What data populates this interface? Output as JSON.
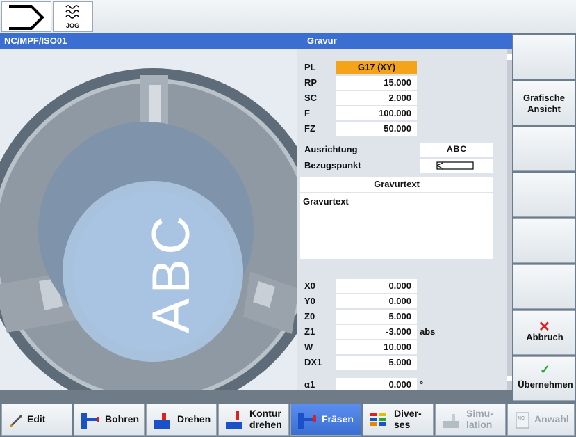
{
  "topbar": {
    "mode_label": "JOG"
  },
  "titlebar": {
    "program": "NC/MPF/ISO01",
    "cycle": "Gravur"
  },
  "graphic": {
    "engrave_text": "ABC"
  },
  "params": {
    "top_rows": [
      {
        "label": "PL",
        "value": "G17 (XY)"
      },
      {
        "label": "RP",
        "value": "15.000"
      },
      {
        "label": "SC",
        "value": "2.000"
      },
      {
        "label": "F",
        "value": "100.000"
      },
      {
        "label": "FZ",
        "value": "50.000"
      }
    ],
    "ausrichtung": {
      "label": "Ausrichtung",
      "value": "ABC"
    },
    "bezugspunkt": {
      "label": "Bezugspunkt"
    },
    "gravurtext": {
      "header": "Gravurtext",
      "value": "Gravurtext"
    },
    "bottom_rows": [
      {
        "label": "X0",
        "value": "0.000",
        "unit": ""
      },
      {
        "label": "Y0",
        "value": "0.000",
        "unit": ""
      },
      {
        "label": "Z0",
        "value": "5.000",
        "unit": ""
      },
      {
        "label": "Z1",
        "value": "-3.000",
        "unit": "abs"
      },
      {
        "label": "W",
        "value": "10.000",
        "unit": ""
      },
      {
        "label": "DX1",
        "value": "5.000",
        "unit": ""
      },
      {
        "label": "α1",
        "value": "0.000",
        "unit": "°"
      }
    ]
  },
  "softkeys": {
    "grafische": "Grafische Ansicht",
    "abbruch": "Abbruch",
    "uebernehmen": "Übernehmen"
  },
  "hkeys": {
    "edit": "Edit",
    "bohren": "Bohren",
    "drehen": "Drehen",
    "kontur_line1": "Kontur",
    "kontur_line2": "drehen",
    "fraesen": "Fräsen",
    "diverses_line1": "Diver-",
    "diverses_line2": "ses",
    "simulation_line1": "Simu-",
    "simulation_line2": "lation",
    "anwahl": "Anwahl"
  },
  "colors": {
    "accent": "#3a6fd1",
    "highlight": "#f5a41a",
    "cancel": "#e02020",
    "ok": "#2aa82a"
  }
}
